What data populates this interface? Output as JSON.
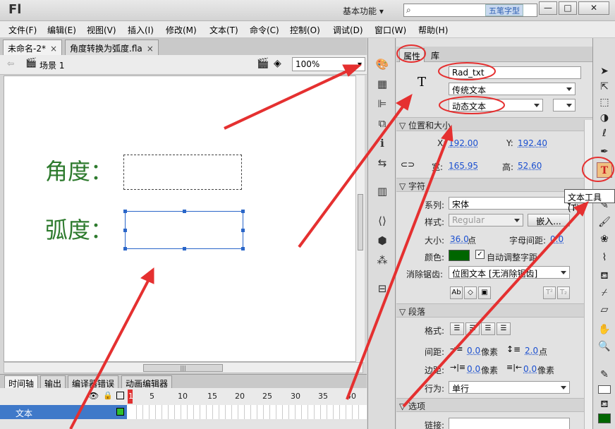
{
  "titlebar": {
    "logo": "Fl",
    "workspace": "基本功能",
    "watermark": "五笔字型",
    "min": "—",
    "max": "□",
    "close": "✕"
  },
  "menus": [
    "文件(F)",
    "编辑(E)",
    "视图(V)",
    "插入(I)",
    "修改(M)",
    "文本(T)",
    "命令(C)",
    "控制(O)",
    "调试(D)",
    "窗口(W)",
    "帮助(H)"
  ],
  "doctabs": [
    {
      "label": "未命名-2*"
    },
    {
      "label": "角度转换为弧度.fla"
    }
  ],
  "scene": {
    "label": "场景 1",
    "zoom": "100%"
  },
  "stage": {
    "text1": "角度：",
    "text2": "弧度："
  },
  "timeline": {
    "tabs": [
      "时间轴",
      "输出",
      "编译器错误",
      "动画编辑器"
    ],
    "frame_numbers": [
      "1",
      "5",
      "10",
      "15",
      "20",
      "25",
      "30",
      "35",
      "40"
    ],
    "layer": "文本"
  },
  "props": {
    "tabs": [
      "属性",
      "库"
    ],
    "instance_name": "Rad_txt",
    "text_engine": "传统文本",
    "text_type": "动态文本",
    "section_position": "位置和大小",
    "x_label": "X:",
    "x_value": "192.00",
    "y_label": "Y:",
    "y_value": "192.40",
    "w_label": "宽:",
    "w_value": "165.95",
    "h_label": "高:",
    "h_value": "52.60",
    "section_char": "字符",
    "family_label": "系列:",
    "family_value": "宋体",
    "style_label": "样式:",
    "style_value": "Regular",
    "embed_button": "嵌入...",
    "size_label": "大小:",
    "size_value": "36.0",
    "size_unit": "点",
    "spacing_label": "字母间距:",
    "spacing_value": "0.0",
    "color_label": "颜色:",
    "color_value": "#006600",
    "autokern_label": "自动调整字距",
    "aa_label": "消除锯齿:",
    "aa_value": "位图文本 [无消除锯齿]",
    "section_para": "段落",
    "format_label": "格式:",
    "gap_label": "间距:",
    "gap_value": "0.0",
    "gap_unit": "像素",
    "lead_value": "2.0",
    "lead_unit": "点",
    "margin_label": "边距:",
    "margin_left": "0.0",
    "margin_left_unit": "像素",
    "margin_right": "0.0",
    "margin_right_unit": "像素",
    "behavior_label": "行为:",
    "behavior_value": "单行",
    "section_options": "选项",
    "link_label": "链接:"
  },
  "tooltip": "文本工具(T)"
}
